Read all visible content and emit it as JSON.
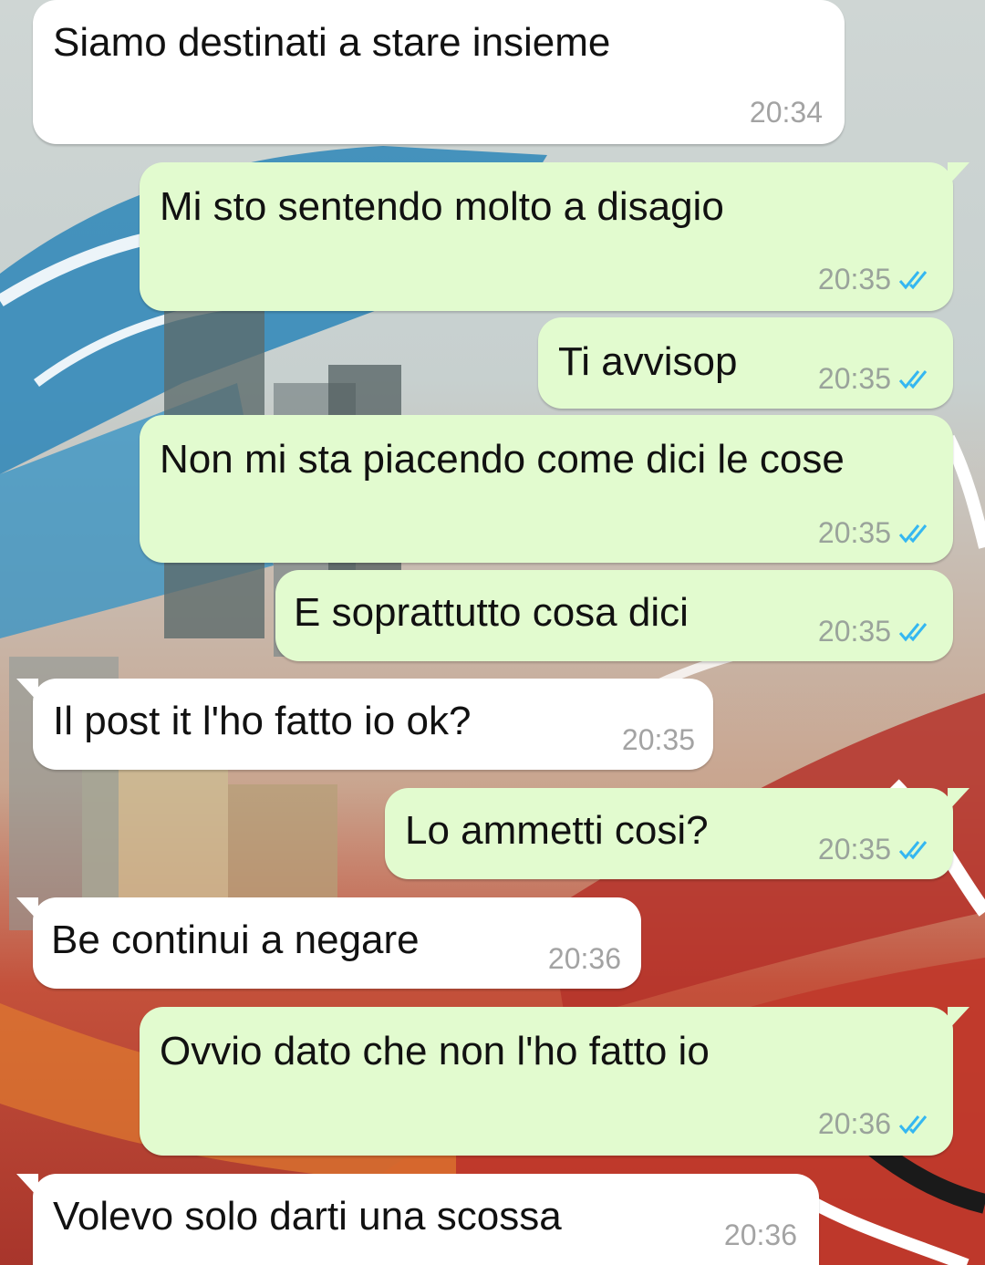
{
  "messages": [
    {
      "text": "Siamo destinati a stare insieme",
      "time": "20:34",
      "direction": "incoming"
    },
    {
      "text": "Mi sto sentendo molto a disagio",
      "time": "20:35",
      "direction": "outgoing",
      "status": "read"
    },
    {
      "text": "Ti avvisop",
      "time": "20:35",
      "direction": "outgoing",
      "status": "read"
    },
    {
      "text": "Non mi sta piacendo come dici le cose",
      "time": "20:35",
      "direction": "outgoing",
      "status": "read"
    },
    {
      "text": "E soprattutto cosa dici",
      "time": "20:35",
      "direction": "outgoing",
      "status": "read"
    },
    {
      "text": "Il post it l'ho fatto io ok?",
      "time": "20:35",
      "direction": "incoming"
    },
    {
      "text": "Lo ammetti cosi?",
      "time": "20:35",
      "direction": "outgoing",
      "status": "read"
    },
    {
      "text": "Be continui a negare",
      "time": "20:36",
      "direction": "incoming"
    },
    {
      "text": "Ovvio dato che non l'ho fatto io",
      "time": "20:36",
      "direction": "outgoing",
      "status": "read"
    },
    {
      "text": "Volevo solo darti una scossa",
      "time": "20:36",
      "direction": "incoming"
    }
  ],
  "colors": {
    "incoming_bubble": "#ffffff",
    "outgoing_bubble": "#e2fbcf",
    "read_ticks": "#34b7f1",
    "timestamp": "#9aa39b"
  },
  "icons": {
    "read_receipt": "double-check-icon"
  }
}
